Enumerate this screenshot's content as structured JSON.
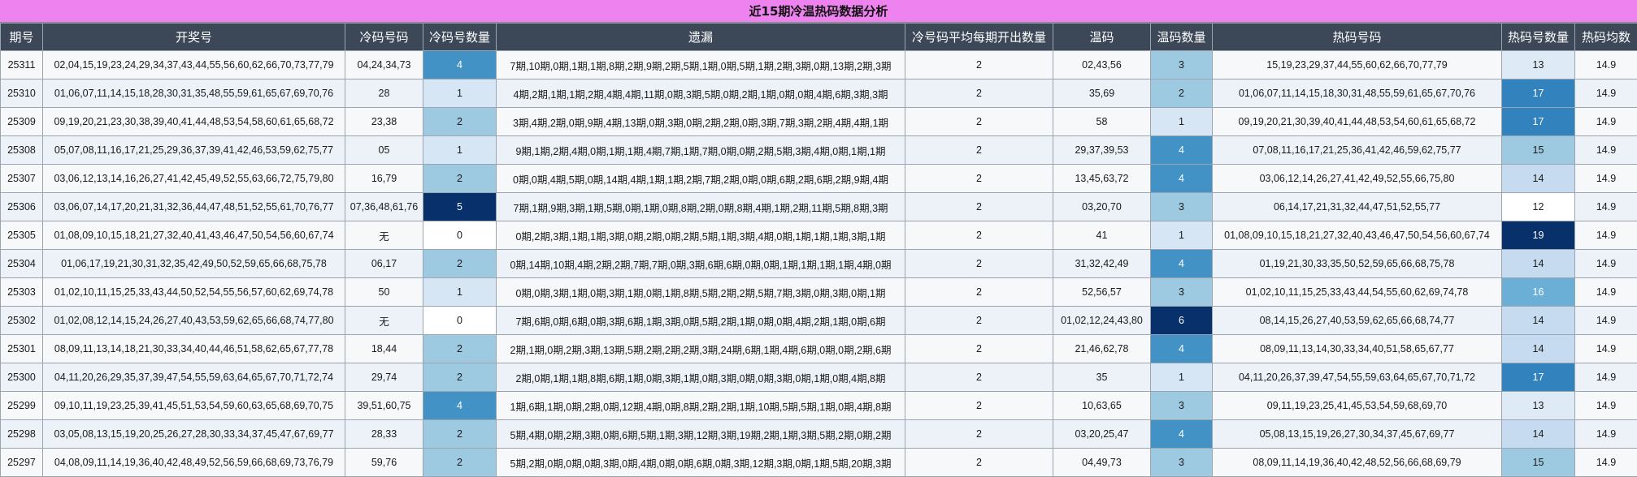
{
  "title": "近15期冷温热码数据分析",
  "colors": {
    "title_bg": "#ee82ee",
    "header_bg": "#3c4758",
    "count_levels": {
      "0": "#ffffff",
      "1": "#d6e6f4",
      "2": "#9ecae1",
      "3": "#9ecae1",
      "4": "#4292c6",
      "5": "#08306b",
      "6": "#08306b"
    },
    "hot_levels": {
      "12": "#ffffff",
      "13": "#deebf7",
      "14": "#c6dbef",
      "15": "#9ecae1",
      "16": "#6baed6",
      "17": "#3182bd",
      "19": "#08306b"
    }
  },
  "columns": [
    "期号",
    "开奖号",
    "冷码号码",
    "冷码号数量",
    "遗漏",
    "冷号码平均每期开出数量",
    "温码",
    "温码数量",
    "热码号码",
    "热码号数量",
    "热码均数"
  ],
  "rows": [
    {
      "period": "25311",
      "draw": "02,04,15,19,23,24,29,34,37,43,44,55,56,60,62,66,70,73,77,79",
      "cold": "04,24,34,73",
      "cold_count": "4",
      "missing": "7期,10期,0期,1期,1期,8期,2期,9期,2期,5期,1期,0期,5期,1期,2期,3期,0期,13期,2期,3期",
      "cold_avg": "2",
      "warm": "02,43,56",
      "warm_count": "3",
      "hot": "15,19,23,29,37,44,55,60,62,66,70,77,79",
      "hot_count": "13",
      "hot_avg": "14.9"
    },
    {
      "period": "25310",
      "draw": "01,06,07,11,14,15,18,28,30,31,35,48,55,59,61,65,67,69,70,76",
      "cold": "28",
      "cold_count": "1",
      "missing": "4期,2期,1期,1期,2期,4期,4期,11期,0期,3期,5期,0期,2期,1期,0期,0期,4期,6期,3期,3期",
      "cold_avg": "2",
      "warm": "35,69",
      "warm_count": "2",
      "hot": "01,06,07,11,14,15,18,30,31,48,55,59,61,65,67,70,76",
      "hot_count": "17",
      "hot_avg": "14.9"
    },
    {
      "period": "25309",
      "draw": "09,19,20,21,23,30,38,39,40,41,44,48,53,54,58,60,61,65,68,72",
      "cold": "23,38",
      "cold_count": "2",
      "missing": "3期,4期,2期,0期,9期,4期,13期,0期,3期,0期,2期,2期,0期,3期,7期,3期,2期,4期,4期,1期",
      "cold_avg": "2",
      "warm": "58",
      "warm_count": "1",
      "hot": "09,19,20,21,30,39,40,41,44,48,53,54,60,61,65,68,72",
      "hot_count": "17",
      "hot_avg": "14.9"
    },
    {
      "period": "25308",
      "draw": "05,07,08,11,16,17,21,25,29,36,37,39,41,42,46,53,59,62,75,77",
      "cold": "05",
      "cold_count": "1",
      "missing": "9期,1期,2期,4期,0期,1期,1期,4期,7期,1期,7期,0期,0期,2期,5期,3期,4期,0期,1期,1期",
      "cold_avg": "2",
      "warm": "29,37,39,53",
      "warm_count": "4",
      "hot": "07,08,11,16,17,21,25,36,41,42,46,59,62,75,77",
      "hot_count": "15",
      "hot_avg": "14.9"
    },
    {
      "period": "25307",
      "draw": "03,06,12,13,14,16,26,27,41,42,45,49,52,55,63,66,72,75,79,80",
      "cold": "16,79",
      "cold_count": "2",
      "missing": "0期,0期,4期,5期,0期,14期,4期,1期,1期,2期,7期,2期,0期,0期,6期,2期,6期,2期,9期,4期",
      "cold_avg": "2",
      "warm": "13,45,63,72",
      "warm_count": "4",
      "hot": "03,06,12,14,26,27,41,42,49,52,55,66,75,80",
      "hot_count": "14",
      "hot_avg": "14.9"
    },
    {
      "period": "25306",
      "draw": "03,06,07,14,17,20,21,31,32,36,44,47,48,51,52,55,61,70,76,77",
      "cold": "07,36,48,61,76",
      "cold_count": "5",
      "missing": "7期,1期,9期,3期,1期,5期,0期,1期,0期,8期,2期,0期,8期,4期,1期,2期,11期,5期,8期,3期",
      "cold_avg": "2",
      "warm": "03,20,70",
      "warm_count": "3",
      "hot": "06,14,17,21,31,32,44,47,51,52,55,77",
      "hot_count": "12",
      "hot_avg": "14.9"
    },
    {
      "period": "25305",
      "draw": "01,08,09,10,15,18,21,27,32,40,41,43,46,47,50,54,56,60,67,74",
      "cold": "无",
      "cold_count": "0",
      "missing": "0期,2期,3期,1期,1期,3期,0期,2期,0期,2期,5期,1期,3期,4期,0期,1期,1期,1期,3期,1期",
      "cold_avg": "2",
      "warm": "41",
      "warm_count": "1",
      "hot": "01,08,09,10,15,18,21,27,32,40,43,46,47,50,54,56,60,67,74",
      "hot_count": "19",
      "hot_avg": "14.9"
    },
    {
      "period": "25304",
      "draw": "01,06,17,19,21,30,31,32,35,42,49,50,52,59,65,66,68,75,78",
      "cold": "06,17",
      "cold_count": "2",
      "missing": "0期,14期,10期,4期,2期,2期,7期,7期,0期,3期,6期,6期,0期,0期,1期,1期,1期,1期,4期,0期",
      "cold_avg": "2",
      "warm": "31,32,42,49",
      "warm_count": "4",
      "hot": "01,19,21,30,33,35,50,52,59,65,66,68,75,78",
      "hot_count": "14",
      "hot_avg": "14.9"
    },
    {
      "period": "25303",
      "draw": "01,02,10,11,15,25,33,43,44,50,52,54,55,56,57,60,62,69,74,78",
      "cold": "50",
      "cold_count": "1",
      "missing": "0期,0期,3期,1期,0期,3期,1期,0期,1期,8期,5期,2期,2期,5期,7期,3期,0期,3期,0期,1期",
      "cold_avg": "2",
      "warm": "52,56,57",
      "warm_count": "3",
      "hot": "01,02,10,11,15,25,33,43,44,54,55,60,62,69,74,78",
      "hot_count": "16",
      "hot_avg": "14.9"
    },
    {
      "period": "25302",
      "draw": "01,02,08,12,14,15,24,26,27,40,43,53,59,62,65,66,68,74,77,80",
      "cold": "无",
      "cold_count": "0",
      "missing": "7期,6期,0期,6期,0期,3期,6期,1期,3期,0期,5期,2期,1期,0期,0期,4期,2期,1期,0期,6期",
      "cold_avg": "2",
      "warm": "01,02,12,24,43,80",
      "warm_count": "6",
      "hot": "08,14,15,26,27,40,53,59,62,65,66,68,74,77",
      "hot_count": "14",
      "hot_avg": "14.9"
    },
    {
      "period": "25301",
      "draw": "08,09,11,13,14,18,21,30,33,34,40,44,46,51,58,62,65,67,77,78",
      "cold": "18,44",
      "cold_count": "2",
      "missing": "2期,1期,0期,2期,3期,13期,5期,2期,2期,2期,3期,24期,6期,1期,4期,6期,0期,0期,2期,6期",
      "cold_avg": "2",
      "warm": "21,46,62,78",
      "warm_count": "4",
      "hot": "08,09,11,13,14,30,33,34,40,51,58,65,67,77",
      "hot_count": "14",
      "hot_avg": "14.9"
    },
    {
      "period": "25300",
      "draw": "04,11,20,26,29,35,37,39,47,54,55,59,63,64,65,67,70,71,72,74",
      "cold": "29,74",
      "cold_count": "2",
      "missing": "2期,0期,1期,1期,8期,6期,1期,0期,3期,1期,0期,3期,0期,0期,3期,0期,1期,0期,4期,8期",
      "cold_avg": "2",
      "warm": "35",
      "warm_count": "1",
      "hot": "04,11,20,26,37,39,47,54,55,59,63,64,65,67,70,71,72",
      "hot_count": "17",
      "hot_avg": "14.9"
    },
    {
      "period": "25299",
      "draw": "09,10,11,19,23,25,39,41,45,51,53,54,59,60,63,65,68,69,70,75",
      "cold": "39,51,60,75",
      "cold_count": "4",
      "missing": "1期,6期,1期,0期,2期,0期,12期,4期,0期,8期,2期,2期,1期,10期,5期,5期,1期,0期,4期,8期",
      "cold_avg": "2",
      "warm": "10,63,65",
      "warm_count": "3",
      "hot": "09,11,19,23,25,41,45,53,54,59,68,69,70",
      "hot_count": "13",
      "hot_avg": "14.9"
    },
    {
      "period": "25298",
      "draw": "03,05,08,13,15,19,20,25,26,27,28,30,33,34,37,45,47,67,69,77",
      "cold": "28,33",
      "cold_count": "2",
      "missing": "5期,4期,0期,2期,3期,0期,6期,5期,1期,3期,12期,3期,19期,2期,1期,3期,5期,2期,0期,2期",
      "cold_avg": "2",
      "warm": "03,20,25,47",
      "warm_count": "4",
      "hot": "05,08,13,15,19,26,27,30,34,37,45,67,69,77",
      "hot_count": "14",
      "hot_avg": "14.9"
    },
    {
      "period": "25297",
      "draw": "04,08,09,11,14,19,36,40,42,48,49,52,56,59,66,68,69,73,76,79",
      "cold": "59,76",
      "cold_count": "2",
      "missing": "5期,2期,0期,0期,0期,3期,0期,4期,0期,0期,6期,0期,3期,12期,3期,0期,1期,5期,20期,3期",
      "cold_avg": "2",
      "warm": "04,49,73",
      "warm_count": "3",
      "hot": "08,09,11,14,19,36,40,42,48,52,56,66,68,69,79",
      "hot_count": "15",
      "hot_avg": "14.9"
    }
  ]
}
